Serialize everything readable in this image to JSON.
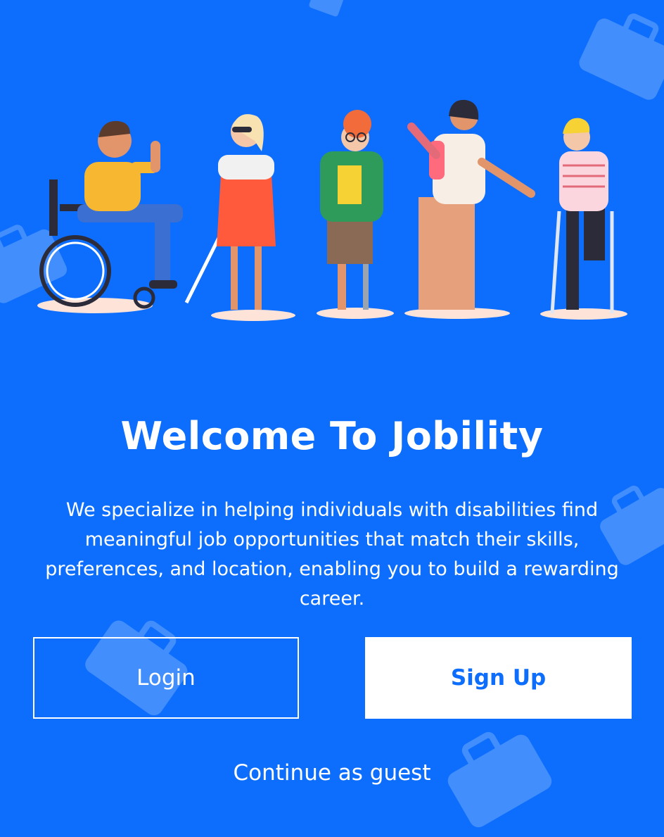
{
  "welcome": {
    "title": "Welcome To Jobility",
    "description": "We specialize in helping individuals with disabilities find meaningful job opportunities that match their skills, preferences, and location, enabling you to build a rewarding career."
  },
  "actions": {
    "login_label": "Login",
    "signup_label": "Sign Up",
    "guest_label": "Continue as guest"
  },
  "colors": {
    "background": "#0d6efd",
    "button_text": "#0d6efd",
    "white": "#ffffff"
  },
  "icons": [
    "briefcase-icon"
  ]
}
